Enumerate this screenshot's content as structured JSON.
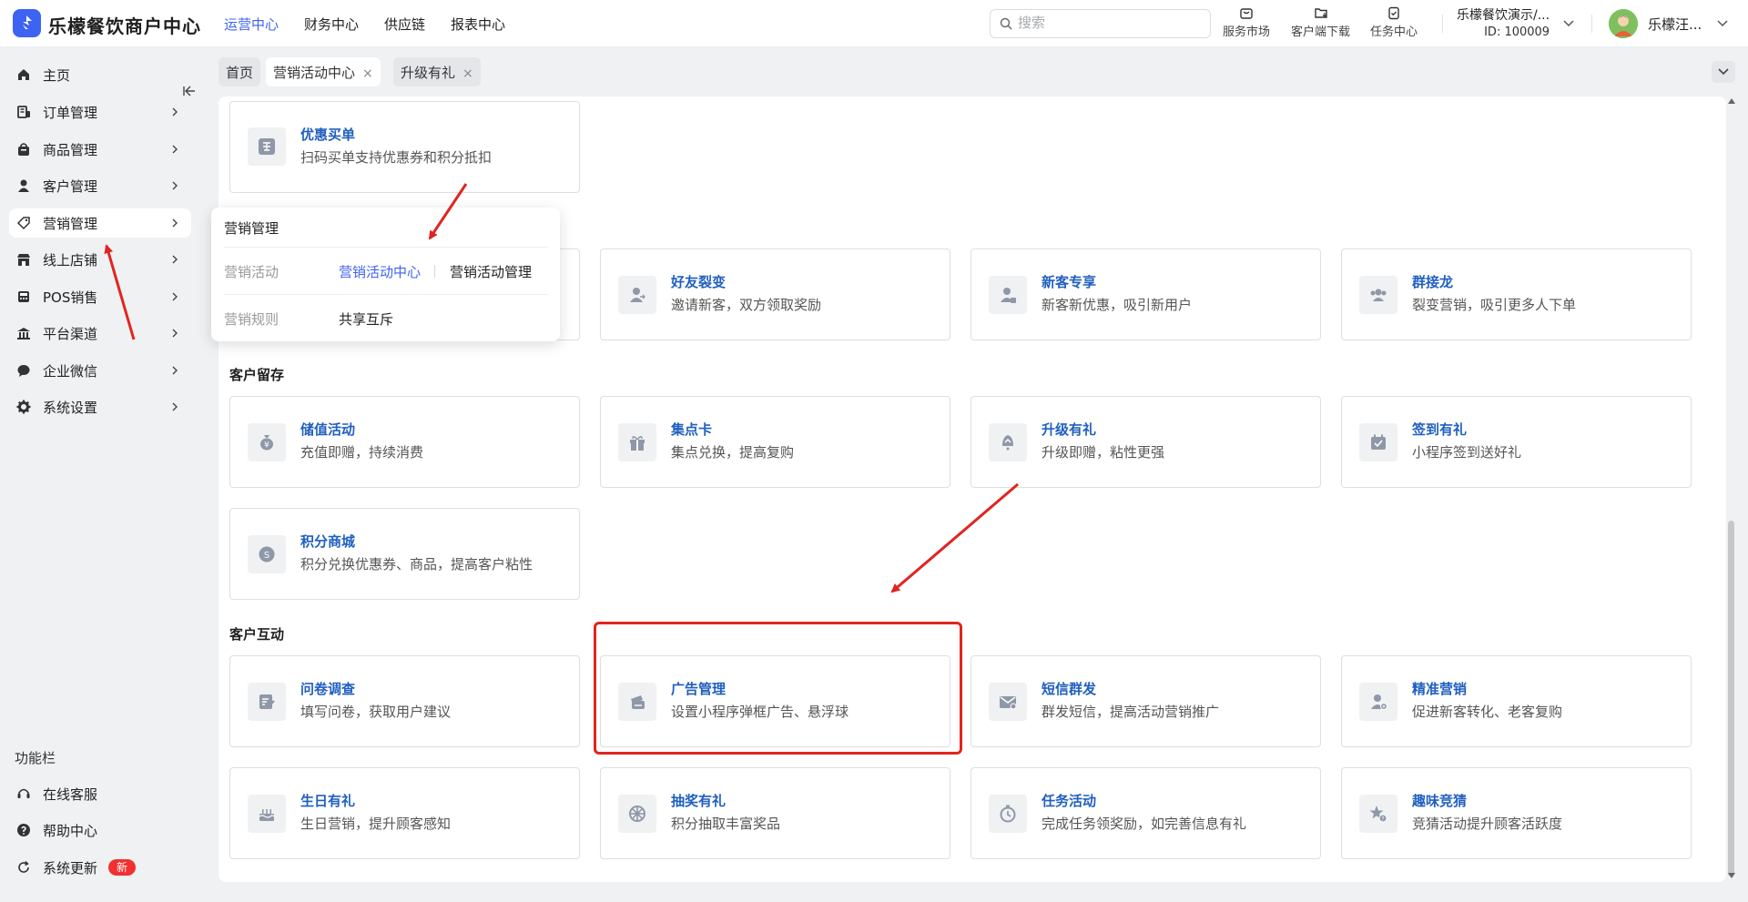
{
  "brand": "乐檬餐饮商户中心",
  "topnav": [
    "运营中心",
    "财务中心",
    "供应链",
    "报表中心"
  ],
  "search": {
    "placeholder": "搜索"
  },
  "tools": {
    "market": "服务市场",
    "download": "客户端下载",
    "tasks": "任务中心"
  },
  "store": {
    "name": "乐檬餐饮演示/...",
    "id": "ID: 100009"
  },
  "user": {
    "name": "乐檬汪..."
  },
  "sidebar": {
    "items": [
      {
        "label": "主页"
      },
      {
        "label": "订单管理"
      },
      {
        "label": "商品管理"
      },
      {
        "label": "客户管理"
      },
      {
        "label": "营销管理"
      },
      {
        "label": "线上店铺"
      },
      {
        "label": "POS销售"
      },
      {
        "label": "平台渠道"
      },
      {
        "label": "企业微信"
      },
      {
        "label": "系统设置"
      }
    ],
    "func_title": "功能栏",
    "func_items": [
      {
        "label": "在线客服"
      },
      {
        "label": "帮助中心"
      },
      {
        "label": "系统更新",
        "badge": "新"
      }
    ]
  },
  "tabs": [
    {
      "label": "首页"
    },
    {
      "label": "营销活动中心",
      "close": "×"
    },
    {
      "label": "升级有礼",
      "close": "×"
    }
  ],
  "popover": {
    "title": "营销管理",
    "row1_label": "营销活动",
    "row1_links": [
      "营销活动中心",
      "营销活动管理"
    ],
    "row2_label": "营销规则",
    "row2_links": [
      "共享互斥"
    ]
  },
  "sections": {
    "retention": "客户留存",
    "interaction": "客户互动"
  },
  "cards": {
    "youhui": {
      "title": "优惠买单",
      "desc": "扫码买单支持优惠券和积分抵扣"
    },
    "haoyou": {
      "title": "好友裂变",
      "desc": "邀请新客，双方领取奖励"
    },
    "xinke": {
      "title": "新客专享",
      "desc": "新客新优惠，吸引新用户"
    },
    "qunjielong": {
      "title": "群接龙",
      "desc": "裂变营销，吸引更多人下单"
    },
    "chuzhi": {
      "title": "储值活动",
      "desc": "充值即赠，持续消费"
    },
    "jidian": {
      "title": "集点卡",
      "desc": "集点兑换，提高复购"
    },
    "shengji": {
      "title": "升级有礼",
      "desc": "升级即赠，粘性更强"
    },
    "qiandao": {
      "title": "签到有礼",
      "desc": "小程序签到送好礼"
    },
    "jifen": {
      "title": "积分商城",
      "desc": "积分兑换优惠券、商品，提高客户粘性"
    },
    "wenjuan": {
      "title": "问卷调查",
      "desc": "填写问卷，获取用户建议"
    },
    "guanggao": {
      "title": "广告管理",
      "desc": "设置小程序弹框广告、悬浮球"
    },
    "duanxin": {
      "title": "短信群发",
      "desc": "群发短信，提高活动营销推广"
    },
    "jingzhun": {
      "title": "精准营销",
      "desc": "促进新客转化、老客复购"
    },
    "shengri": {
      "title": "生日有礼",
      "desc": "生日营销，提升顾客感知"
    },
    "choujiang": {
      "title": "抽奖有礼",
      "desc": "积分抽取丰富奖品"
    },
    "renwu": {
      "title": "任务活动",
      "desc": "完成任务领奖励，如完善信息有礼"
    },
    "quwei": {
      "title": "趣味竞猜",
      "desc": "竞猜活动提升顾客活跃度"
    }
  },
  "colors": {
    "accent": "#3d63f2",
    "card_title": "#1f5fbf",
    "annotation_red": "#e0251f"
  }
}
